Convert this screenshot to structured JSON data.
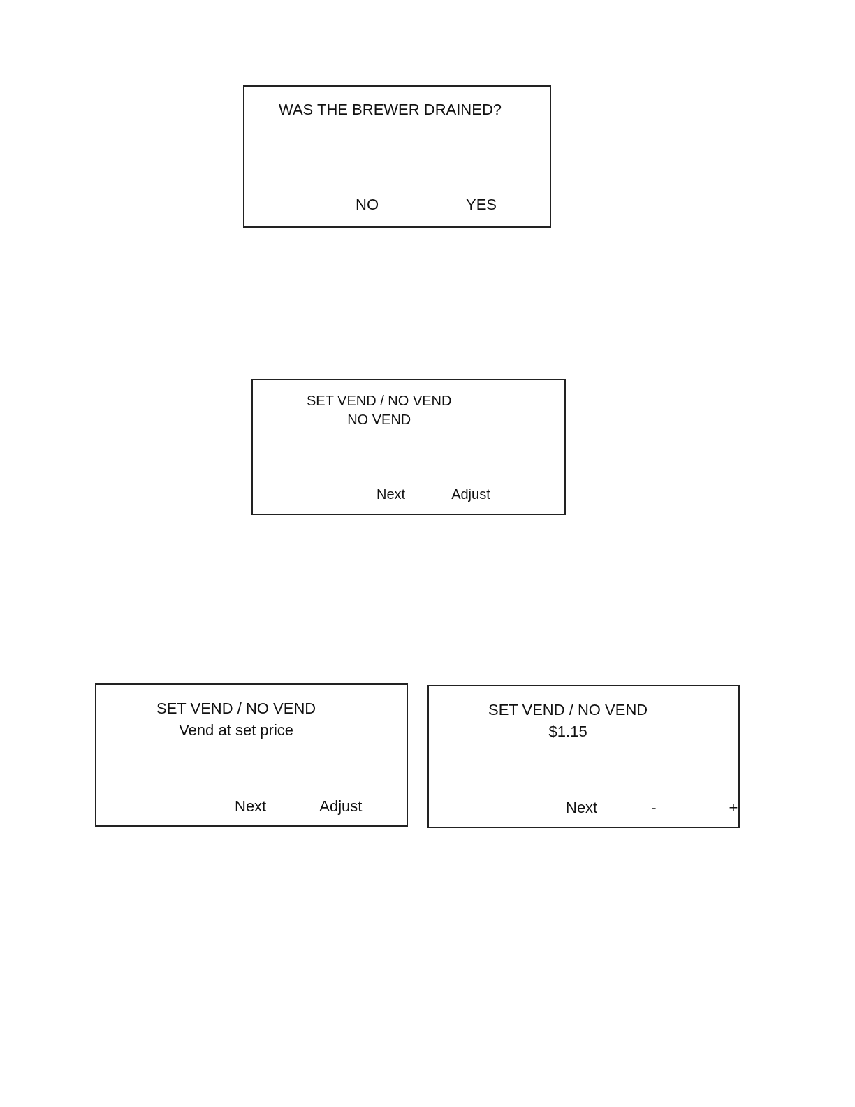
{
  "screens": [
    {
      "lines": [
        "WAS THE BREWER DRAINED?"
      ],
      "softkeys": [
        "NO",
        "YES"
      ]
    },
    {
      "lines": [
        "SET VEND / NO VEND",
        "NO VEND"
      ],
      "softkeys": [
        "Next",
        "Adjust"
      ]
    },
    {
      "lines": [
        "SET VEND / NO VEND",
        "Vend at set price"
      ],
      "softkeys": [
        "Next",
        "Adjust"
      ]
    },
    {
      "lines": [
        "SET VEND / NO VEND",
        "$1.15"
      ],
      "softkeys": [
        "Next",
        "-",
        "+"
      ]
    }
  ]
}
